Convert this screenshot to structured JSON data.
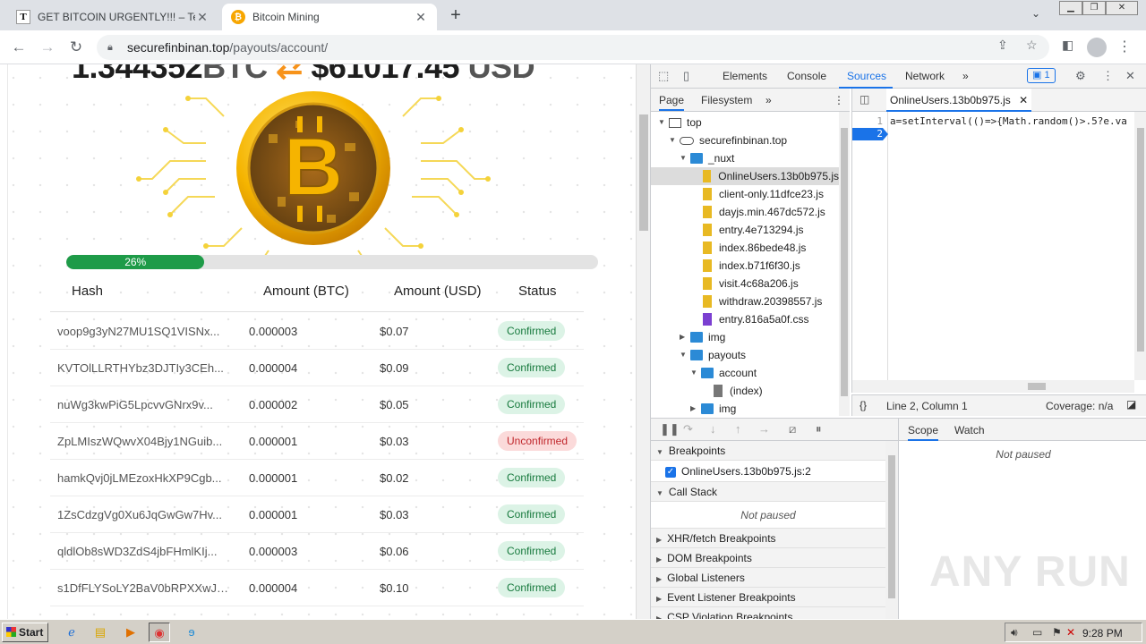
{
  "browser": {
    "tabs": [
      {
        "title": "GET BITCOIN URGENTLY!!! – Telegram",
        "favicon": "T"
      },
      {
        "title": "Bitcoin Mining",
        "favicon": "₿"
      }
    ],
    "new_tab_label": "+",
    "address": {
      "host": "securefinbinan.top",
      "path": "/payouts/account/"
    }
  },
  "page": {
    "balance": {
      "btc_value": "1.344352",
      "btc_unit": "BTC",
      "swap_symbol": "⇄",
      "usd_value": "$61017.45",
      "usd_unit": "USD"
    },
    "progress": {
      "percent": 26,
      "label": "26%"
    },
    "table": {
      "headers": [
        "Hash",
        "Amount (BTC)",
        "Amount (USD)",
        "Status"
      ],
      "rows": [
        {
          "hash": "voop9g3yN27MU1SQ1VISNx...",
          "btc": "0.000003",
          "usd": "$0.07",
          "status": "Confirmed"
        },
        {
          "hash": "KVTOlLLRTHYbz3DJTIy3CEh...",
          "btc": "0.000004",
          "usd": "$0.09",
          "status": "Confirmed"
        },
        {
          "hash": "nuWg3kwPiG5LpcvvGNrx9v...",
          "btc": "0.000002",
          "usd": "$0.05",
          "status": "Confirmed"
        },
        {
          "hash": "ZpLMIszWQwvX04Bjy1NGuib...",
          "btc": "0.000001",
          "usd": "$0.03",
          "status": "Unconfirmed"
        },
        {
          "hash": "hamkQvj0jLMEzoxHkXP9Cgb...",
          "btc": "0.000001",
          "usd": "$0.02",
          "status": "Confirmed"
        },
        {
          "hash": "1ZsCdzgVg0Xu6JqGwGw7Hv...",
          "btc": "0.000001",
          "usd": "$0.03",
          "status": "Confirmed"
        },
        {
          "hash": "qldlOb8sWD3ZdS4jbFHmlKIj...",
          "btc": "0.000003",
          "usd": "$0.06",
          "status": "Confirmed"
        },
        {
          "hash": "s1DfFLYSoLY2BaV0bRPXXwJ5...",
          "btc": "0.000004",
          "usd": "$0.10",
          "status": "Confirmed"
        }
      ]
    }
  },
  "devtools": {
    "tabs": [
      "Elements",
      "Console",
      "Sources",
      "Network"
    ],
    "more_tabs": "»",
    "issues_count": "1",
    "navigator": {
      "tabs": [
        "Page",
        "Filesystem"
      ],
      "tree": [
        {
          "label": "top",
          "kind": "frame",
          "level": 0,
          "open": true
        },
        {
          "label": "securefinbinan.top",
          "kind": "cloud",
          "level": 1,
          "open": true
        },
        {
          "label": "_nuxt",
          "kind": "folder",
          "level": 2,
          "open": true
        },
        {
          "label": "OnlineUsers.13b0b975.js",
          "kind": "file",
          "level": 3,
          "selected": true
        },
        {
          "label": "client-only.11dfce23.js",
          "kind": "file",
          "level": 3
        },
        {
          "label": "dayjs.min.467dc572.js",
          "kind": "file",
          "level": 3
        },
        {
          "label": "entry.4e713294.js",
          "kind": "file",
          "level": 3
        },
        {
          "label": "index.86bede48.js",
          "kind": "file",
          "level": 3
        },
        {
          "label": "index.b71f6f30.js",
          "kind": "file",
          "level": 3
        },
        {
          "label": "visit.4c68a206.js",
          "kind": "file",
          "level": 3
        },
        {
          "label": "withdraw.20398557.js",
          "kind": "file",
          "level": 3
        },
        {
          "label": "entry.816a5a0f.css",
          "kind": "css",
          "level": 3
        },
        {
          "label": "img",
          "kind": "folder",
          "level": 2,
          "open": false
        },
        {
          "label": "payouts",
          "kind": "folder",
          "level": 2,
          "open": true
        },
        {
          "label": "account",
          "kind": "folder",
          "level": 3,
          "open": true
        },
        {
          "label": "(index)",
          "kind": "doc",
          "level": 4
        },
        {
          "label": "img",
          "kind": "folder",
          "level": 3,
          "open": false
        }
      ]
    },
    "editor": {
      "tab_label": "OnlineUsers.13b0b975.js",
      "lines": [
        "1",
        "2"
      ],
      "code_line_1": "a=setInterval(()=>{Math.random()>.5?e.va",
      "status_position": "Line 2, Column 1",
      "status_coverage": "Coverage: n/a",
      "format_label": "{}"
    },
    "debugger": {
      "sections": {
        "breakpoints": "Breakpoints",
        "breakpoint_item": "OnlineUsers.13b0b975.js:2",
        "call_stack": "Call Stack",
        "not_paused": "Not paused",
        "xhr": "XHR/fetch Breakpoints",
        "dom": "DOM Breakpoints",
        "global": "Global Listeners",
        "event": "Event Listener Breakpoints",
        "csp": "CSP Violation Breakpoints"
      },
      "scope_tabs": [
        "Scope",
        "Watch"
      ],
      "scope_status": "Not paused"
    }
  },
  "watermark": "ANY RUN",
  "taskbar": {
    "start_label": "Start",
    "clock": "9:28 PM"
  }
}
